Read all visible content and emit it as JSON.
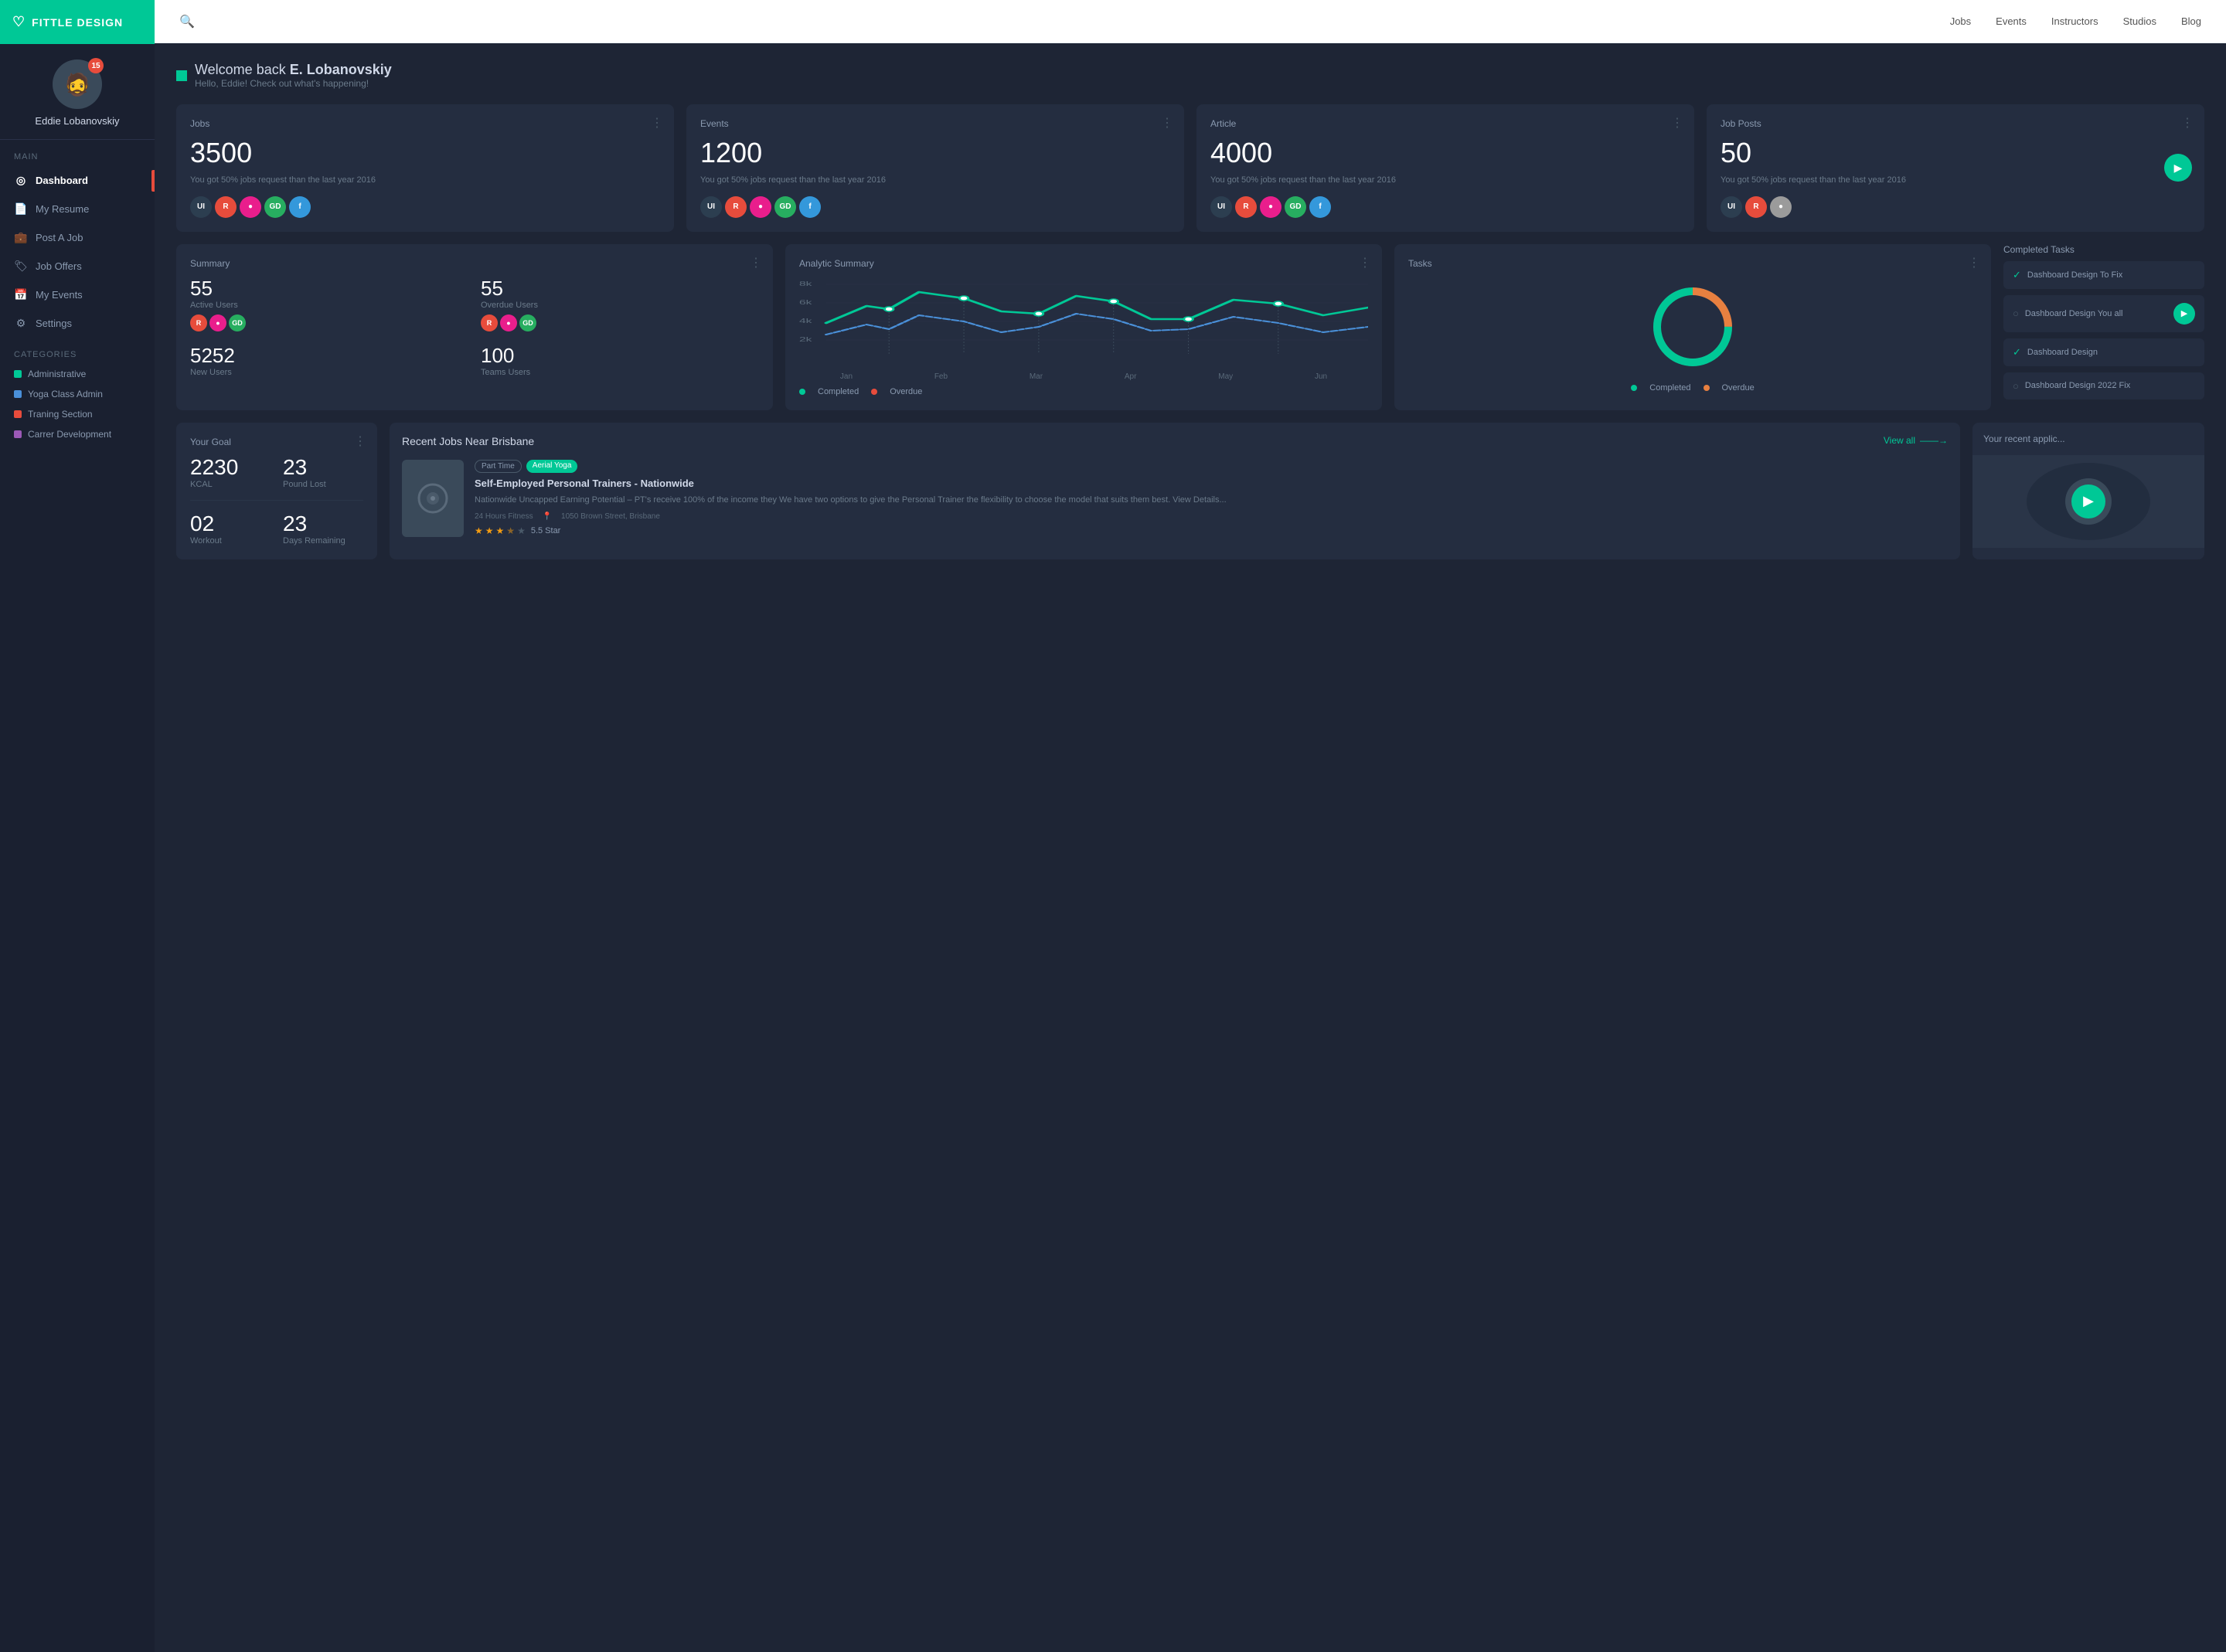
{
  "app": {
    "name": "FITTLE DESIGN",
    "logo_icon": "♡"
  },
  "user": {
    "name": "Eddie Lobanovskiy",
    "notifications": 15,
    "avatar_emoji": "🧔"
  },
  "nav": {
    "main_label": "Main",
    "items": [
      {
        "id": "dashboard",
        "label": "Dashboard",
        "icon": "◎",
        "active": true
      },
      {
        "id": "resume",
        "label": "My Resume",
        "icon": "📄"
      },
      {
        "id": "post-job",
        "label": "Post A Job",
        "icon": "💼"
      },
      {
        "id": "job-offers",
        "label": "Job Offers",
        "icon": "🏷"
      },
      {
        "id": "events",
        "label": "My Events",
        "icon": "📅"
      },
      {
        "id": "settings",
        "label": "Settings",
        "icon": "⚙"
      }
    ],
    "categories_label": "Categories",
    "categories": [
      {
        "label": "Administrative",
        "color": "#00c896"
      },
      {
        "label": "Yoga Class Admin",
        "color": "#4a90d9"
      },
      {
        "label": "Traning Section",
        "color": "#e74c3c"
      },
      {
        "label": "Carrer Development",
        "color": "#9b59b6"
      }
    ]
  },
  "topbar": {
    "search_placeholder": "Search...",
    "nav_items": [
      "Jobs",
      "Events",
      "Instructors",
      "Studios",
      "Blog"
    ]
  },
  "welcome": {
    "greeting": "Welcome back",
    "name": "E. Lobanovskiy",
    "subtext": "Hello, Eddie! Check out what's happening!"
  },
  "stat_cards": [
    {
      "title": "Jobs",
      "value": "3500",
      "sub": "You got 50% jobs request than the last year 2016",
      "avatars": [
        "#2c3e50",
        "#e74c3c",
        "#e91e8c",
        "#27ae60",
        "#3498db"
      ]
    },
    {
      "title": "Events",
      "value": "1200",
      "sub": "You got 50% jobs request than the last year 2016",
      "avatars": [
        "#2c3e50",
        "#e74c3c",
        "#e91e8c",
        "#27ae60",
        "#3498db"
      ]
    },
    {
      "title": "Article",
      "value": "4000",
      "sub": "You got 50% jobs request than the last year 2016",
      "avatars": [
        "#2c3e50",
        "#e74c3c",
        "#e91e8c",
        "#27ae60",
        "#3498db"
      ]
    },
    {
      "title": "Job Posts",
      "value": "50",
      "sub": "You got 50% jobs request than the last year 2016",
      "has_play": true,
      "avatars": [
        "#2c3e50",
        "#e74c3c",
        "#9b9b9b"
      ]
    }
  ],
  "summary": {
    "title": "Summary",
    "stats": [
      {
        "num": "55",
        "label": "Active Users",
        "avatars": [
          "#e74c3c",
          "#e91e8c",
          "#27ae60"
        ]
      },
      {
        "num": "55",
        "label": "Overdue Users",
        "avatars": [
          "#e74c3c",
          "#e91e8c",
          "#27ae60"
        ]
      },
      {
        "num": "5252",
        "label": "New Users",
        "avatars": []
      },
      {
        "num": "100",
        "label": "Teams Users",
        "avatars": []
      }
    ]
  },
  "analytic": {
    "title": "Analytic Summary",
    "chart_labels": [
      "Jan",
      "Feb",
      "Mar",
      "Apr",
      "May",
      "Jun"
    ],
    "legend": [
      {
        "label": "Completed",
        "color": "#00c896"
      },
      {
        "label": "Overdue",
        "color": "#e74c3c"
      }
    ]
  },
  "tasks": {
    "title": "Tasks",
    "completed_label": "Completed",
    "overdue_label": "Overdue",
    "donut_completed_pct": 75
  },
  "completed_tasks": {
    "title": "Completed Tasks",
    "items": [
      {
        "text": "Dashboard Design To Fix",
        "time": "",
        "checked": true,
        "has_play": false
      },
      {
        "text": "Dashboard Design You all",
        "time": "",
        "checked": false,
        "has_play": true
      },
      {
        "text": "Dashboard Design",
        "time": "",
        "checked": true,
        "has_play": false
      },
      {
        "text": "Dashboard Design 2022 Fix",
        "time": "",
        "checked": false,
        "has_play": false
      }
    ]
  },
  "your_goal": {
    "title": "Your Goal",
    "stats": [
      {
        "num": "2230",
        "label": "KCAL"
      },
      {
        "num": "23",
        "label": "Pound Lost"
      },
      {
        "num": "02",
        "label": "Workout"
      },
      {
        "num": "23",
        "label": "Days Remaining"
      }
    ]
  },
  "recent_jobs": {
    "title": "Recent Jobs Near Brisbane",
    "view_all": "View all",
    "job": {
      "tags": [
        {
          "label": "Part Time",
          "type": "outline"
        },
        {
          "label": "Aerial Yoga",
          "type": "green"
        }
      ],
      "title": "Self-Employed Personal Trainers - Nationwide",
      "desc": "Nationwide Uncapped Earning Potential – PT's receive 100% of the income they We have two options to give the Personal Trainer the flexibility to choose the model that suits them best. View Details...",
      "company": "24 Hours Fitness",
      "location": "1050 Brown Street, Brisbane",
      "stars": 3.5,
      "rating_text": "5.5 Star"
    }
  },
  "recent_apps": {
    "title": "Your recent applic..."
  },
  "avatar_labels": [
    "UI",
    "R",
    "GD",
    "F"
  ]
}
